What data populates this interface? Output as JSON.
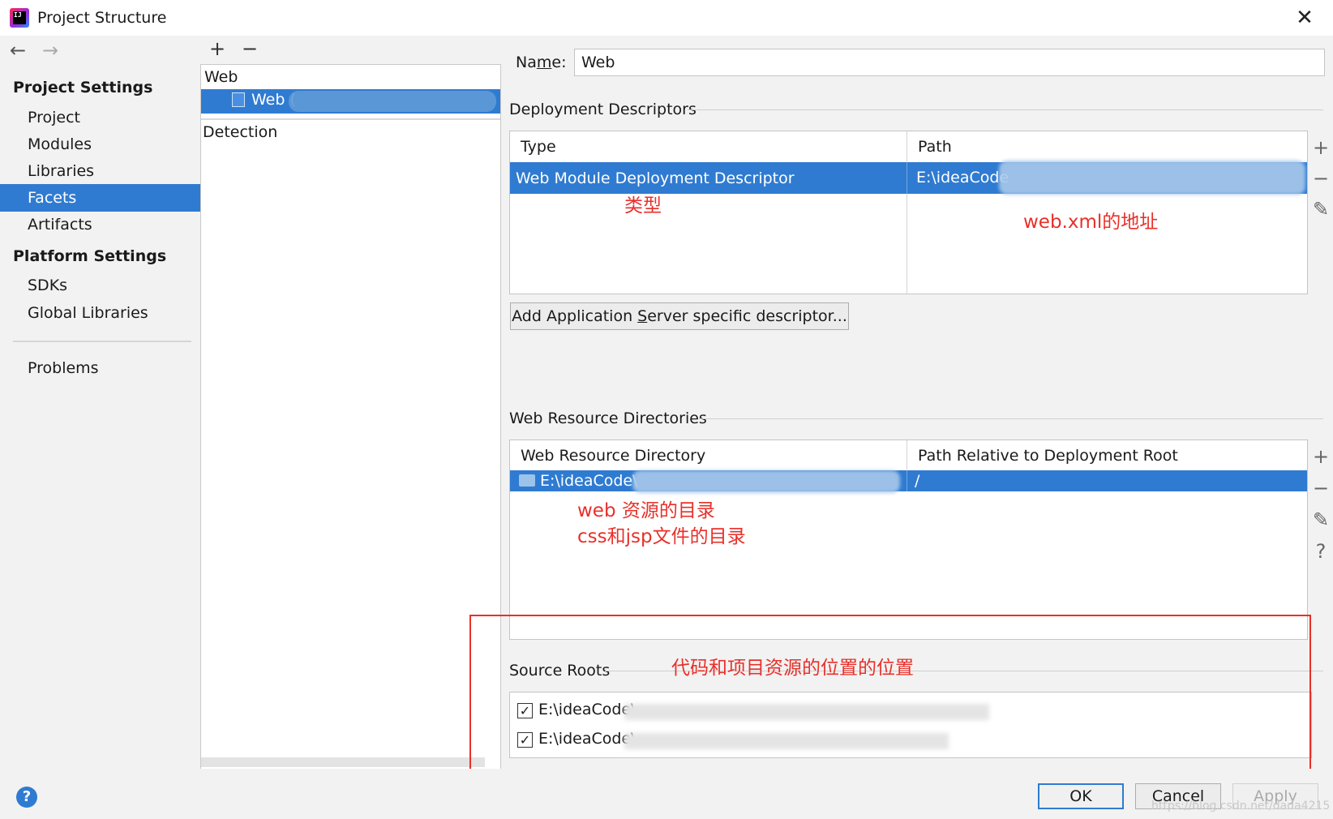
{
  "window": {
    "title": "Project Structure",
    "close": "✕"
  },
  "nav": {
    "back": "←",
    "forward": "→"
  },
  "sidebar": {
    "project_settings": "Project Settings",
    "project_items": [
      {
        "label": "Project"
      },
      {
        "label": "Modules"
      },
      {
        "label": "Libraries"
      },
      {
        "label": "Facets",
        "selected": true
      },
      {
        "label": "Artifacts"
      }
    ],
    "platform_settings": "Platform Settings",
    "platform_items": [
      {
        "label": "SDKs"
      },
      {
        "label": "Global Libraries"
      }
    ],
    "problems": "Problems"
  },
  "facets": {
    "add": "+",
    "remove": "−",
    "group": "Web",
    "item": "Web (",
    "detection": "Detection"
  },
  "name": {
    "label_pre": "Na",
    "label_ul": "m",
    "label_post": "e:",
    "value": "Web"
  },
  "deployment": {
    "title": "Deployment Descriptors",
    "columns": [
      "Type",
      "Path"
    ],
    "row": {
      "type": "Web Module Deployment Descriptor",
      "path": "E:\\ideaCode"
    },
    "add_button_pre": "Add Application ",
    "add_button_ul": "S",
    "add_button_post": "erver specific descriptor..."
  },
  "web_resources": {
    "title": "Web Resource Directories",
    "columns": [
      "Web Resource Directory",
      "Path Relative to Deployment Root"
    ],
    "row": {
      "dir": "E:\\ideaCode\\",
      "path": "/"
    }
  },
  "source_roots": {
    "title": "Source Roots",
    "items": [
      {
        "label": "E:\\ideaCode\\",
        "checked": true
      },
      {
        "label": "E:\\ideaCode\\",
        "checked": true
      }
    ]
  },
  "annotations": {
    "type": "类型",
    "webxml": "web.xml的地址",
    "web_dir_1": "web 资源的目录",
    "web_dir_2": "css和jsp文件的目录",
    "source": "代码和项目资源的位置的位置"
  },
  "tools": {
    "add": "+",
    "remove": "−",
    "edit": "✎",
    "help": "?"
  },
  "buttons": {
    "ok": "OK",
    "cancel": "Cancel",
    "apply": "Apply",
    "help": "?"
  },
  "watermark": "https://blog.csdn.net/dada4215",
  "colors": {
    "selection": "#2f7bd1",
    "annotation": "#e8302a"
  }
}
